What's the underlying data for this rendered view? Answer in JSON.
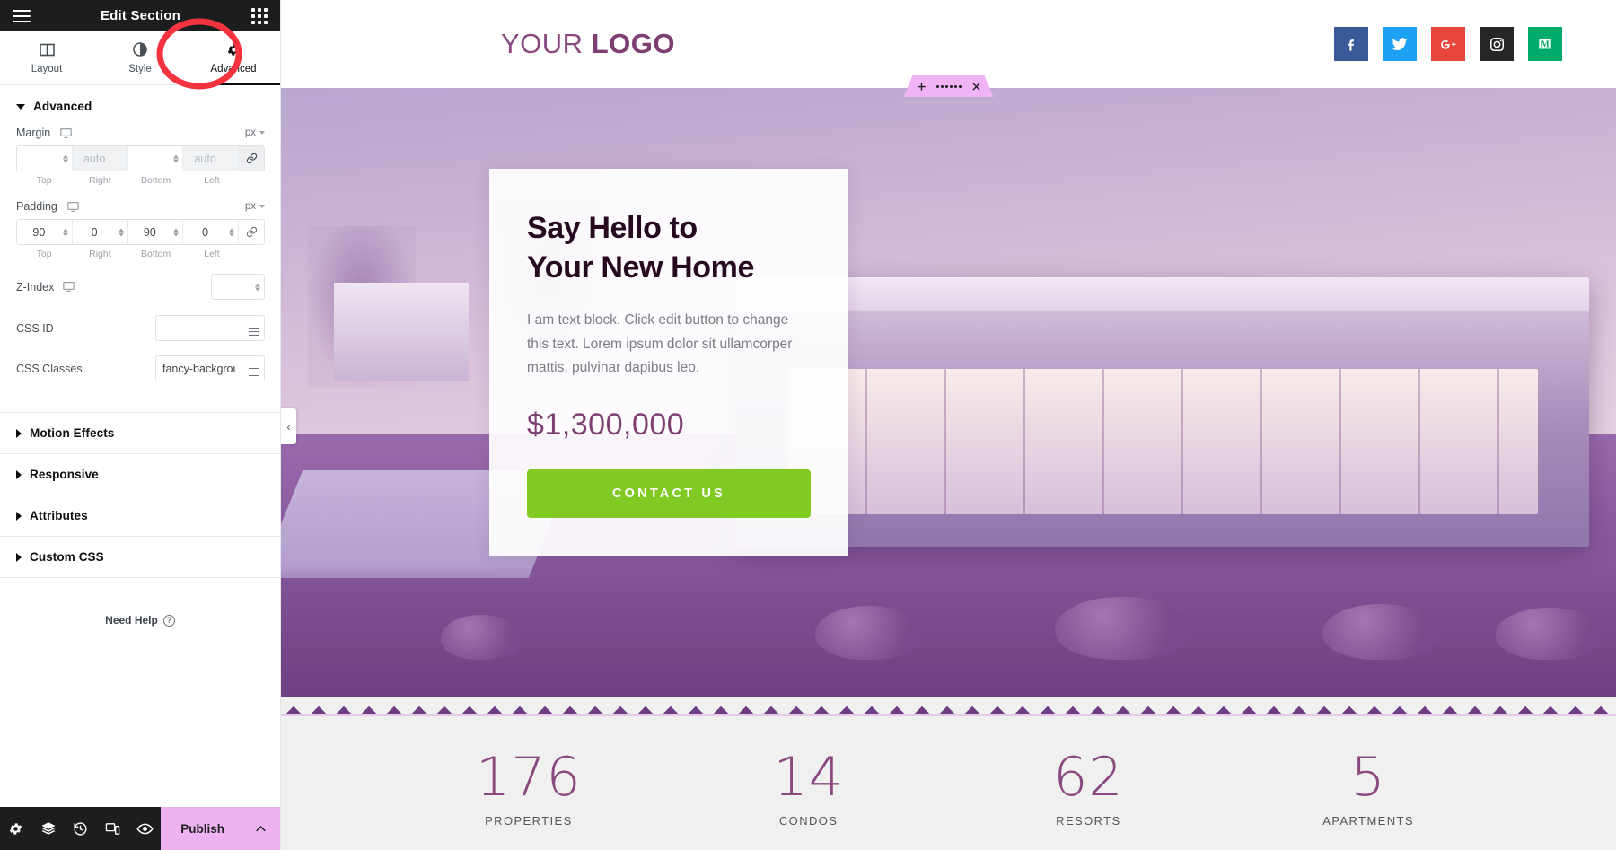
{
  "panel": {
    "header": {
      "title": "Edit Section",
      "menu_icon": "hamburger-icon",
      "apps_icon": "grid-apps-icon"
    },
    "tabs": [
      {
        "label": "Layout",
        "icon": "layout-columns-icon",
        "active": false
      },
      {
        "label": "Style",
        "icon": "contrast-circle-icon",
        "active": false
      },
      {
        "label": "Advanced",
        "icon": "gear-icon",
        "active": true
      }
    ],
    "section": {
      "title": "Advanced",
      "expanded": true
    },
    "margin": {
      "label": "Margin",
      "device_icon": "desktop-icon",
      "unit": "px",
      "linked": true,
      "fields": [
        {
          "side": "Top",
          "value": "",
          "placeholder": "",
          "auto": false
        },
        {
          "side": "Right",
          "value": "",
          "placeholder": "auto",
          "auto": true
        },
        {
          "side": "Bottom",
          "value": "",
          "placeholder": "",
          "auto": false
        },
        {
          "side": "Left",
          "value": "",
          "placeholder": "auto",
          "auto": true
        }
      ]
    },
    "padding": {
      "label": "Padding",
      "device_icon": "desktop-icon",
      "unit": "px",
      "linked": false,
      "fields": [
        {
          "side": "Top",
          "value": "90",
          "placeholder": "",
          "auto": false
        },
        {
          "side": "Right",
          "value": "0",
          "placeholder": "",
          "auto": false
        },
        {
          "side": "Bottom",
          "value": "90",
          "placeholder": "",
          "auto": false
        },
        {
          "side": "Left",
          "value": "0",
          "placeholder": "",
          "auto": false
        }
      ]
    },
    "z_index": {
      "label": "Z-Index",
      "device_icon": "desktop-icon",
      "value": "",
      "placeholder": ""
    },
    "css_id": {
      "label": "CSS ID",
      "value": "",
      "placeholder": ""
    },
    "css_classes": {
      "label": "CSS Classes",
      "value": "fancy-backgroun",
      "placeholder": ""
    },
    "accordions": [
      {
        "label": "Motion Effects",
        "expanded": false
      },
      {
        "label": "Responsive",
        "expanded": false
      },
      {
        "label": "Attributes",
        "expanded": false
      },
      {
        "label": "Custom CSS",
        "expanded": false
      }
    ],
    "need_help": {
      "label": "Need Help",
      "icon": "question-circle-icon"
    },
    "footer": {
      "icons": [
        "settings-gear-icon",
        "layers-navigator-icon",
        "history-revisions-icon",
        "responsive-mode-icon",
        "preview-eye-icon"
      ],
      "publish_label": "Publish",
      "publish_chevron": "chevron-up-icon",
      "publish_color": "#eeb2f0"
    },
    "collapse_handle": {
      "icon": "chevron-left-icon"
    }
  },
  "canvas": {
    "section_toolbar": {
      "add_icon": "plus-icon",
      "drag_icon": "drag-dots-icon",
      "close_icon": "close-x-icon",
      "color": "#f0b3f5"
    },
    "site_header": {
      "logo_light": "YOUR",
      "logo_bold": "LOGO",
      "socials": [
        {
          "name": "facebook-icon",
          "color": "#3b5998"
        },
        {
          "name": "twitter-icon",
          "color": "#1da1f2"
        },
        {
          "name": "google-plus-icon",
          "color": "#e8453c"
        },
        {
          "name": "instagram-icon",
          "color": "#262626"
        },
        {
          "name": "medium-icon",
          "color": "#00ab6c"
        }
      ]
    },
    "hero": {
      "heading_line1": "Say Hello to",
      "heading_line2": "Your New Home",
      "body": "I am text block. Click edit button to change this text. Lorem ipsum dolor sit ullamcorper mattis, pulvinar dapibus leo.",
      "price": "$1,300,000",
      "cta_label": "CONTACT US",
      "cta_color": "#81c923"
    },
    "stats": [
      {
        "number": "176",
        "label": "PROPERTIES"
      },
      {
        "number": "14",
        "label": "CONDOS"
      },
      {
        "number": "62",
        "label": "RESORTS"
      },
      {
        "number": "5",
        "label": "APARTMENTS"
      }
    ]
  }
}
